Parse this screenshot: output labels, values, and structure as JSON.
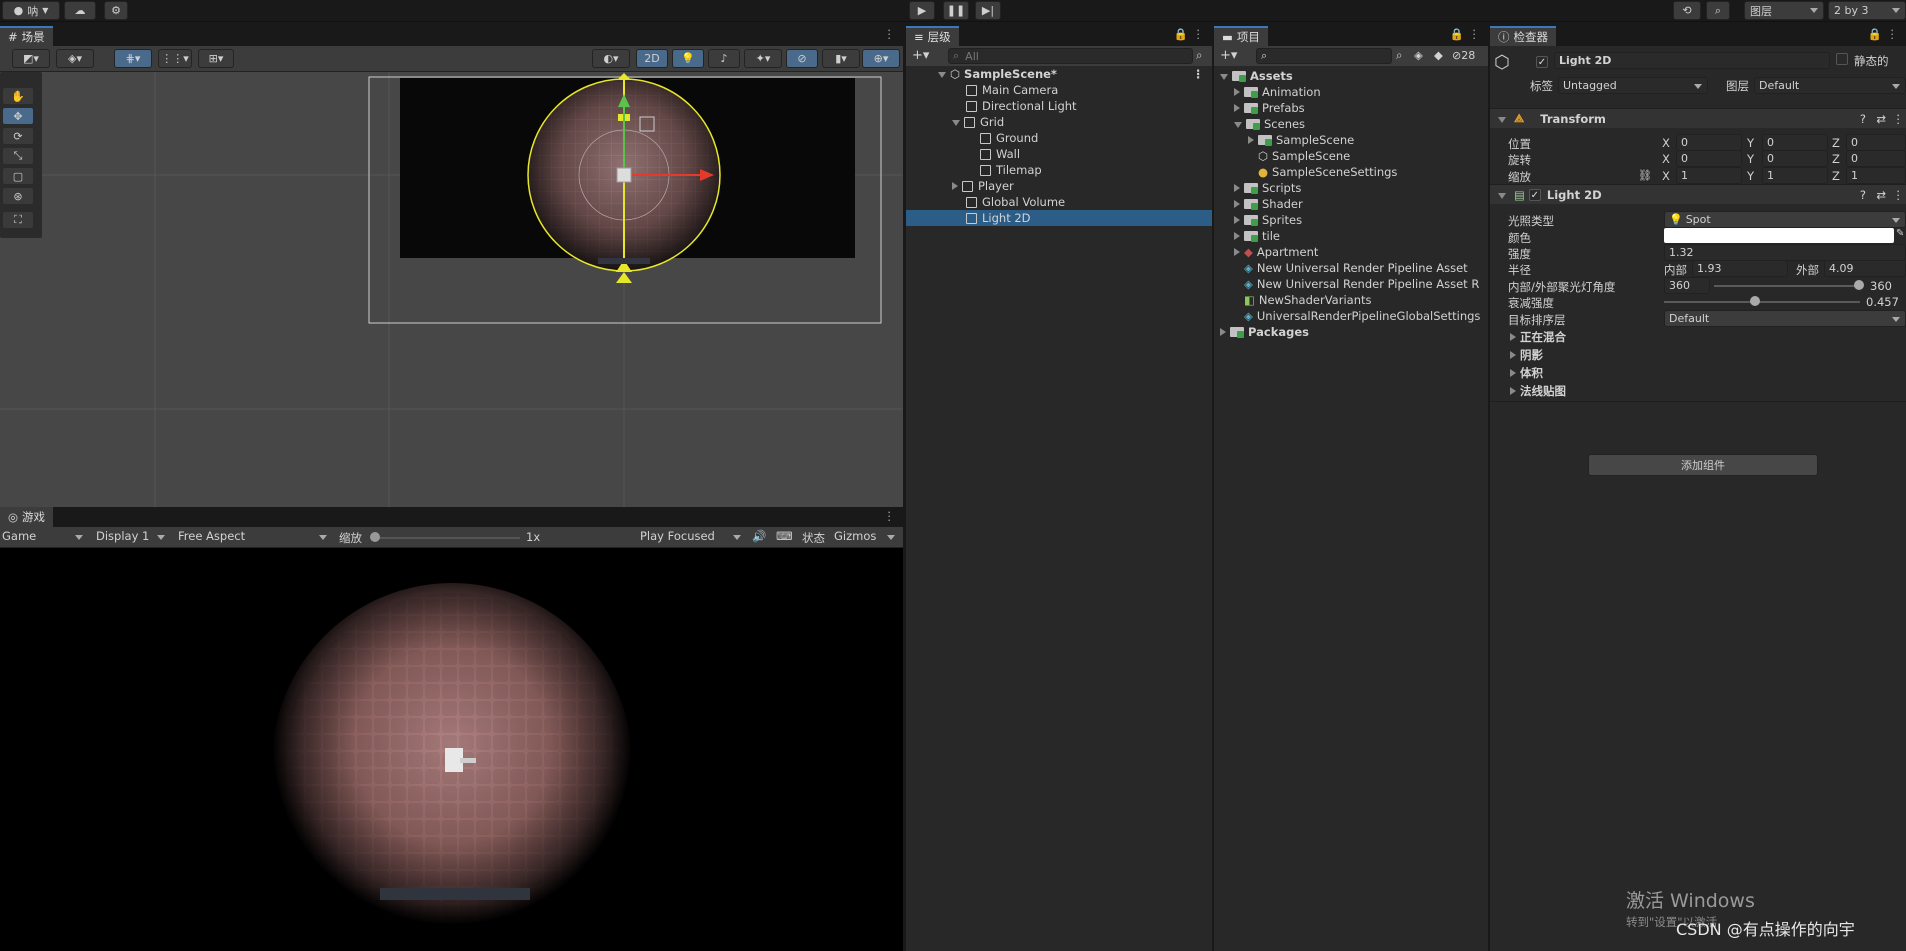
{
  "toolbar": {
    "account": "呐",
    "layers": "图层",
    "layout": "2 by 3"
  },
  "scene": {
    "tab": "场景",
    "mode2d": "2D"
  },
  "game": {
    "tab": "游戏",
    "game_dropdown": "Game",
    "display": "Display 1",
    "aspect": "Free Aspect",
    "scale_label": "缩放",
    "scale_value": "1x",
    "play_focused": "Play Focused",
    "stats": "状态",
    "gizmos": "Gizmos"
  },
  "hierarchy": {
    "tab": "层级",
    "search_placeholder": "All",
    "items": [
      {
        "label": "SampleScene*"
      },
      {
        "label": "Main Camera"
      },
      {
        "label": "Directional Light"
      },
      {
        "label": "Grid"
      },
      {
        "label": "Ground"
      },
      {
        "label": "Wall"
      },
      {
        "label": "Tilemap"
      },
      {
        "label": "Player"
      },
      {
        "label": "Global Volume"
      },
      {
        "label": "Light 2D"
      }
    ]
  },
  "project": {
    "tab": "项目",
    "hidden_count": "28",
    "items": [
      {
        "label": "Assets"
      },
      {
        "label": "Animation"
      },
      {
        "label": "Prefabs"
      },
      {
        "label": "Scenes"
      },
      {
        "label": "SampleScene"
      },
      {
        "label": "SampleScene"
      },
      {
        "label": "SampleSceneSettings"
      },
      {
        "label": "Scripts"
      },
      {
        "label": "Shader"
      },
      {
        "label": "Sprites"
      },
      {
        "label": "tile"
      },
      {
        "label": "Apartment"
      },
      {
        "label": "New Universal Render Pipeline Asset"
      },
      {
        "label": "New Universal Render Pipeline Asset R"
      },
      {
        "label": "NewShaderVariants"
      },
      {
        "label": "UniversalRenderPipelineGlobalSettings"
      },
      {
        "label": "Packages"
      }
    ]
  },
  "inspector": {
    "tab": "检查器",
    "object_name": "Light 2D",
    "static_label": "静态的",
    "tag_label": "标签",
    "tag_value": "Untagged",
    "layer_label": "图层",
    "layer_value": "Default",
    "transform": {
      "title": "Transform",
      "position_label": "位置",
      "rotation_label": "旋转",
      "scale_label": "缩放",
      "position": {
        "x": "0",
        "y": "0",
        "z": "0"
      },
      "rotation": {
        "x": "0",
        "y": "0",
        "z": "0"
      },
      "scale": {
        "x": "1",
        "y": "1",
        "z": "1"
      },
      "axis_x": "X",
      "axis_y": "Y",
      "axis_z": "Z"
    },
    "light": {
      "title": "Light 2D",
      "type_label": "光照类型",
      "type_value": "Spot",
      "color_label": "颜色",
      "intensity_label": "强度",
      "intensity_value": "1.32",
      "radius_label": "半径",
      "inner_label": "内部",
      "inner_value": "1.93",
      "outer_label": "外部",
      "outer_value": "4.09",
      "angle_label": "内部/外部聚光灯角度",
      "angle_inner": "360",
      "angle_outer": "360",
      "falloff_label": "衰减强度",
      "falloff_value": "0.457",
      "sort_label": "目标排序层",
      "sort_value": "Default"
    },
    "foldouts": [
      "正在混合",
      "阴影",
      "体积",
      "法线贴图"
    ],
    "add_component": "添加组件"
  },
  "watermark": {
    "line1": "激活 Windows",
    "line2": "转到\"设置\"以激活",
    "csdn": "CSDN @有点操作的向宇"
  },
  "colors": {
    "accent": "#3a79bb",
    "selection": "#2c5d87",
    "bg": "#282828"
  }
}
